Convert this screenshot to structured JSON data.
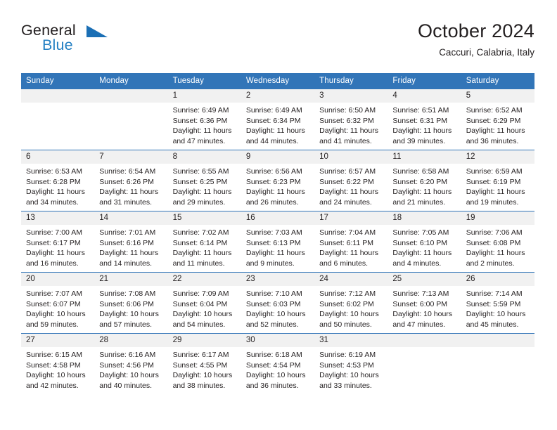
{
  "brand": {
    "name_part1": "General",
    "name_part2": "Blue",
    "triangle_icon": "triangle-icon",
    "color_dark": "#231f20",
    "color_blue": "#2580c3"
  },
  "header": {
    "title": "October 2024",
    "location": "Caccuri, Calabria, Italy",
    "accent_color": "#3275b8",
    "daynum_bg": "#f1f1f1"
  },
  "weekday_headers": [
    "Sunday",
    "Monday",
    "Tuesday",
    "Wednesday",
    "Thursday",
    "Friday",
    "Saturday"
  ],
  "labels": {
    "sunrise_prefix": "Sunrise:",
    "sunset_prefix": "Sunset:",
    "daylight_prefix": "Daylight:"
  },
  "weeks": [
    [
      {
        "day": "",
        "blank": true,
        "line1": "",
        "line2": "",
        "line3": "",
        "line4": ""
      },
      {
        "day": "",
        "blank": true,
        "line1": "",
        "line2": "",
        "line3": "",
        "line4": ""
      },
      {
        "day": "1",
        "line1": "Sunrise: 6:49 AM",
        "line2": "Sunset: 6:36 PM",
        "line3": "Daylight: 11 hours",
        "line4": "and 47 minutes."
      },
      {
        "day": "2",
        "line1": "Sunrise: 6:49 AM",
        "line2": "Sunset: 6:34 PM",
        "line3": "Daylight: 11 hours",
        "line4": "and 44 minutes."
      },
      {
        "day": "3",
        "line1": "Sunrise: 6:50 AM",
        "line2": "Sunset: 6:32 PM",
        "line3": "Daylight: 11 hours",
        "line4": "and 41 minutes."
      },
      {
        "day": "4",
        "line1": "Sunrise: 6:51 AM",
        "line2": "Sunset: 6:31 PM",
        "line3": "Daylight: 11 hours",
        "line4": "and 39 minutes."
      },
      {
        "day": "5",
        "line1": "Sunrise: 6:52 AM",
        "line2": "Sunset: 6:29 PM",
        "line3": "Daylight: 11 hours",
        "line4": "and 36 minutes."
      }
    ],
    [
      {
        "day": "6",
        "line1": "Sunrise: 6:53 AM",
        "line2": "Sunset: 6:28 PM",
        "line3": "Daylight: 11 hours",
        "line4": "and 34 minutes."
      },
      {
        "day": "7",
        "line1": "Sunrise: 6:54 AM",
        "line2": "Sunset: 6:26 PM",
        "line3": "Daylight: 11 hours",
        "line4": "and 31 minutes."
      },
      {
        "day": "8",
        "line1": "Sunrise: 6:55 AM",
        "line2": "Sunset: 6:25 PM",
        "line3": "Daylight: 11 hours",
        "line4": "and 29 minutes."
      },
      {
        "day": "9",
        "line1": "Sunrise: 6:56 AM",
        "line2": "Sunset: 6:23 PM",
        "line3": "Daylight: 11 hours",
        "line4": "and 26 minutes."
      },
      {
        "day": "10",
        "line1": "Sunrise: 6:57 AM",
        "line2": "Sunset: 6:22 PM",
        "line3": "Daylight: 11 hours",
        "line4": "and 24 minutes."
      },
      {
        "day": "11",
        "line1": "Sunrise: 6:58 AM",
        "line2": "Sunset: 6:20 PM",
        "line3": "Daylight: 11 hours",
        "line4": "and 21 minutes."
      },
      {
        "day": "12",
        "line1": "Sunrise: 6:59 AM",
        "line2": "Sunset: 6:19 PM",
        "line3": "Daylight: 11 hours",
        "line4": "and 19 minutes."
      }
    ],
    [
      {
        "day": "13",
        "line1": "Sunrise: 7:00 AM",
        "line2": "Sunset: 6:17 PM",
        "line3": "Daylight: 11 hours",
        "line4": "and 16 minutes."
      },
      {
        "day": "14",
        "line1": "Sunrise: 7:01 AM",
        "line2": "Sunset: 6:16 PM",
        "line3": "Daylight: 11 hours",
        "line4": "and 14 minutes."
      },
      {
        "day": "15",
        "line1": "Sunrise: 7:02 AM",
        "line2": "Sunset: 6:14 PM",
        "line3": "Daylight: 11 hours",
        "line4": "and 11 minutes."
      },
      {
        "day": "16",
        "line1": "Sunrise: 7:03 AM",
        "line2": "Sunset: 6:13 PM",
        "line3": "Daylight: 11 hours",
        "line4": "and 9 minutes."
      },
      {
        "day": "17",
        "line1": "Sunrise: 7:04 AM",
        "line2": "Sunset: 6:11 PM",
        "line3": "Daylight: 11 hours",
        "line4": "and 6 minutes."
      },
      {
        "day": "18",
        "line1": "Sunrise: 7:05 AM",
        "line2": "Sunset: 6:10 PM",
        "line3": "Daylight: 11 hours",
        "line4": "and 4 minutes."
      },
      {
        "day": "19",
        "line1": "Sunrise: 7:06 AM",
        "line2": "Sunset: 6:08 PM",
        "line3": "Daylight: 11 hours",
        "line4": "and 2 minutes."
      }
    ],
    [
      {
        "day": "20",
        "line1": "Sunrise: 7:07 AM",
        "line2": "Sunset: 6:07 PM",
        "line3": "Daylight: 10 hours",
        "line4": "and 59 minutes."
      },
      {
        "day": "21",
        "line1": "Sunrise: 7:08 AM",
        "line2": "Sunset: 6:06 PM",
        "line3": "Daylight: 10 hours",
        "line4": "and 57 minutes."
      },
      {
        "day": "22",
        "line1": "Sunrise: 7:09 AM",
        "line2": "Sunset: 6:04 PM",
        "line3": "Daylight: 10 hours",
        "line4": "and 54 minutes."
      },
      {
        "day": "23",
        "line1": "Sunrise: 7:10 AM",
        "line2": "Sunset: 6:03 PM",
        "line3": "Daylight: 10 hours",
        "line4": "and 52 minutes."
      },
      {
        "day": "24",
        "line1": "Sunrise: 7:12 AM",
        "line2": "Sunset: 6:02 PM",
        "line3": "Daylight: 10 hours",
        "line4": "and 50 minutes."
      },
      {
        "day": "25",
        "line1": "Sunrise: 7:13 AM",
        "line2": "Sunset: 6:00 PM",
        "line3": "Daylight: 10 hours",
        "line4": "and 47 minutes."
      },
      {
        "day": "26",
        "line1": "Sunrise: 7:14 AM",
        "line2": "Sunset: 5:59 PM",
        "line3": "Daylight: 10 hours",
        "line4": "and 45 minutes."
      }
    ],
    [
      {
        "day": "27",
        "line1": "Sunrise: 6:15 AM",
        "line2": "Sunset: 4:58 PM",
        "line3": "Daylight: 10 hours",
        "line4": "and 42 minutes."
      },
      {
        "day": "28",
        "line1": "Sunrise: 6:16 AM",
        "line2": "Sunset: 4:56 PM",
        "line3": "Daylight: 10 hours",
        "line4": "and 40 minutes."
      },
      {
        "day": "29",
        "line1": "Sunrise: 6:17 AM",
        "line2": "Sunset: 4:55 PM",
        "line3": "Daylight: 10 hours",
        "line4": "and 38 minutes."
      },
      {
        "day": "30",
        "line1": "Sunrise: 6:18 AM",
        "line2": "Sunset: 4:54 PM",
        "line3": "Daylight: 10 hours",
        "line4": "and 36 minutes."
      },
      {
        "day": "31",
        "line1": "Sunrise: 6:19 AM",
        "line2": "Sunset: 4:53 PM",
        "line3": "Daylight: 10 hours",
        "line4": "and 33 minutes."
      },
      {
        "day": "",
        "blank": true,
        "line1": "",
        "line2": "",
        "line3": "",
        "line4": ""
      },
      {
        "day": "",
        "blank": true,
        "line1": "",
        "line2": "",
        "line3": "",
        "line4": ""
      }
    ]
  ]
}
